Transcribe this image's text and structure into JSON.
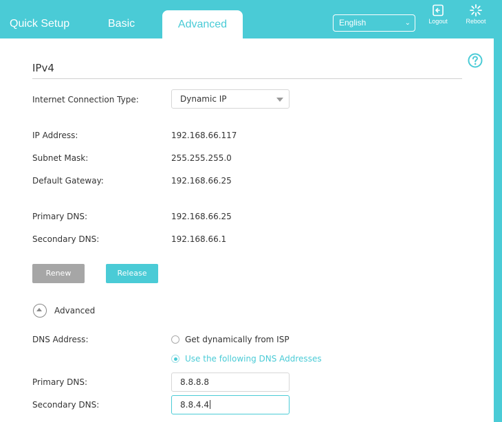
{
  "nav": {
    "tabs": [
      {
        "label": "Quick Setup"
      },
      {
        "label": "Basic"
      },
      {
        "label": "Advanced"
      }
    ],
    "language": "English",
    "logout_label": "Logout",
    "reboot_label": "Reboot"
  },
  "colors": {
    "accent": "#4acbd6",
    "button_gray": "#a6a6a6"
  },
  "ipv4": {
    "section_title": "IPv4",
    "connection_type_label": "Internet Connection Type:",
    "connection_type_value": "Dynamic IP",
    "ip_address_label": "IP Address:",
    "ip_address_value": "192.168.66.117",
    "subnet_mask_label": "Subnet Mask:",
    "subnet_mask_value": "255.255.255.0",
    "gateway_label": "Default Gateway:",
    "gateway_value": "192.168.66.25",
    "primary_dns_label": "Primary DNS:",
    "primary_dns_value": "192.168.66.25",
    "secondary_dns_label": "Secondary DNS:",
    "secondary_dns_value": "192.168.66.1",
    "renew_label": "Renew",
    "release_label": "Release"
  },
  "advanced": {
    "toggle_label": "Advanced",
    "dns_address_label": "DNS Address:",
    "option_isp": "Get dynamically from ISP",
    "option_manual": "Use the following DNS Addresses",
    "selected_option": "Use the following DNS Addresses",
    "primary_dns_label": "Primary DNS:",
    "primary_dns_value": "8.8.8.8",
    "secondary_dns_label": "Secondary DNS:",
    "secondary_dns_value": "8.8.4.4"
  },
  "icons": {
    "help": "help-icon",
    "logout": "logout-icon",
    "reboot": "reboot-icon"
  }
}
